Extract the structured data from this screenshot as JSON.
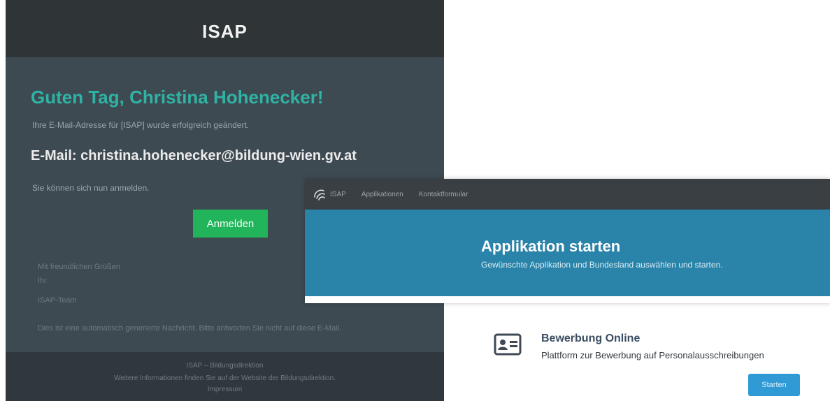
{
  "email": {
    "title": "ISAP",
    "greeting": "Guten Tag, Christina Hohenecker!",
    "changed_text": "Ihre E-Mail-Adresse für [ISAP] wurde erfolgreich geändert.",
    "email_line": "E-Mail: christina.hohenecker@bildung-wien.gv.at",
    "login_text": "Sie können sich nun anmelden.",
    "login_button": "Anmelden",
    "signature": [
      "Mit freundlichen Grüßen",
      "Ihr",
      "ISAP-Team"
    ],
    "disclaimer": "Dies ist eine automatisch generierte Nachricht. Bitte antworten Sie nicht auf diese E-Mail.",
    "footer": [
      "ISAP – Bildungsdirektion",
      "Weitere Informationen finden Sie auf der Website der Bildungsdirektion.",
      "Impressum"
    ]
  },
  "app": {
    "brand": "ISAP",
    "nav": [
      "Applikationen",
      "Kontaktformular"
    ],
    "hero_title": "Applikation starten",
    "hero_subtitle": "Gewünschte Applikation und Bundesland auswählen und starten.",
    "card": {
      "icon": "id-card-icon",
      "title": "Bewerbung Online",
      "description": "Plattform zur Bewerbung auf Personalausschreibungen",
      "button": "Starten"
    }
  },
  "colors": {
    "email_bg": "#3e4a52",
    "email_header": "#2f3437",
    "greeting": "#2fb3a4",
    "login_button": "#22b45a",
    "navbar": "#3a3f44",
    "hero": "#2a83a8",
    "start_button": "#2f9ad6"
  }
}
